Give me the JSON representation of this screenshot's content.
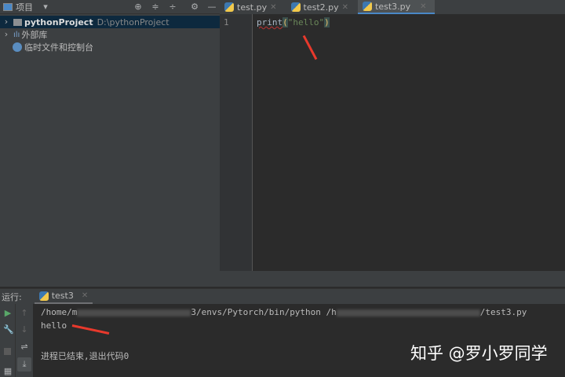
{
  "project_panel": {
    "title": "项目",
    "tree": [
      {
        "label": "pythonProject",
        "path": "D:\\pythonProject"
      },
      {
        "label": "外部库"
      },
      {
        "label": "临时文件和控制台"
      }
    ]
  },
  "editor": {
    "tabs": [
      {
        "label": "test.py"
      },
      {
        "label": "test2.py"
      },
      {
        "label": "test3.py",
        "active": true
      }
    ],
    "line_number": "1",
    "code": {
      "fn": "print",
      "open": "(",
      "str": "\"hello\"",
      "close": ")"
    }
  },
  "run": {
    "label": "运行:",
    "tab": "test3",
    "cmd_a": "/home/m",
    "cmd_b": "3/envs/Pytorch/bin/python /h",
    "cmd_c": "/test3.py",
    "output": "hello",
    "exit": "进程已结束,退出代码0"
  },
  "watermark": "知乎 @罗小罗同学"
}
